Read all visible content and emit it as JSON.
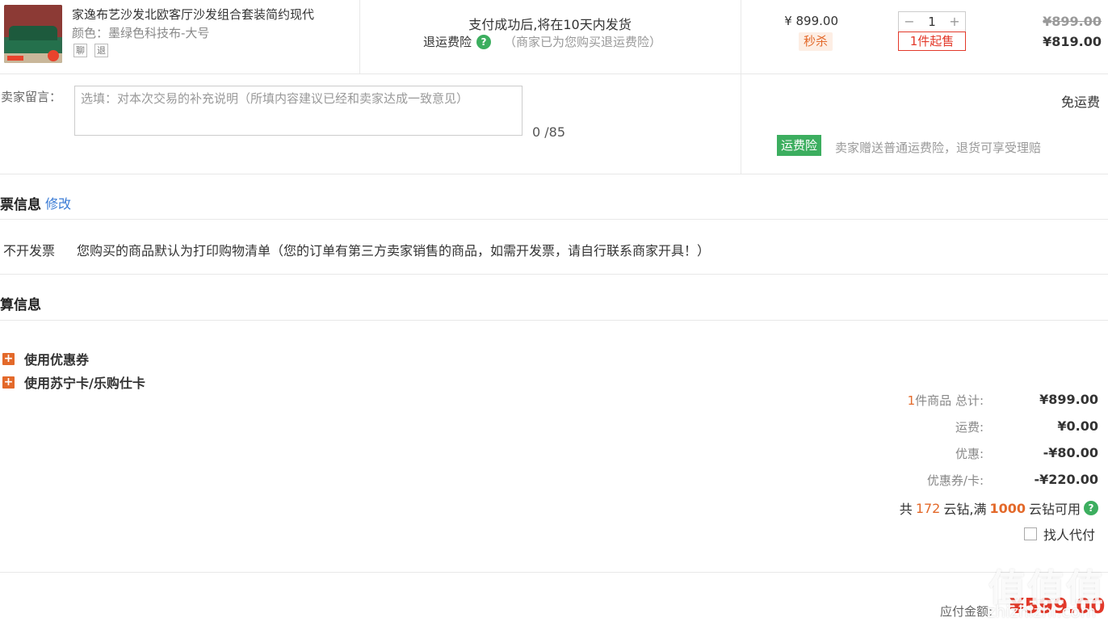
{
  "product": {
    "title": "家逸布艺沙发北欧客厅沙发组合套装简约现代",
    "color": "颜色：墨绿色科技布-大号",
    "badge_1": "聊",
    "badge_2": "退",
    "ship_note": "支付成功后,将在10天内发货",
    "return_label": "退运费险",
    "return_note": "（商家已为您购买退运费险）",
    "unit_price": "¥ 899.00",
    "flash_tag": "秒杀",
    "qty_minus": "−",
    "qty_value": "1",
    "qty_plus": "+",
    "min_buy": "1件起售",
    "orig_price": "¥899.00",
    "now_price": "¥819.00"
  },
  "message": {
    "label": "给卖家留言：",
    "placeholder": "选填：对本次交易的补充说明（所填内容建议已经和卖家达成一致意见）",
    "count": "0 /85",
    "free_shipping": "免运费",
    "insurance_tag": "运费险",
    "insurance_note": "卖家赠送普通运费险，退货可享受理赔"
  },
  "invoice": {
    "title": "发票信息",
    "modify": "修改",
    "type": "不开发票",
    "note": "您购买的商品默认为打印购物清单（您的订单有第三方卖家销售的商品，如需开发票，请自行联系商家开具！）"
  },
  "settlement": {
    "title": "结算信息",
    "use_coupon": "使用优惠券",
    "use_card": "使用苏宁卡/乐购仕卡",
    "count_num": "1",
    "total_label": "件商品 总计:",
    "total_value": "¥899.00",
    "freight_label": "运费:",
    "freight_value": "¥0.00",
    "discount_label": "优惠:",
    "discount_value": "-¥80.00",
    "coupon_label": "优惠券/卡:",
    "coupon_value": "-¥220.00",
    "diamond_prefix": "共",
    "diamond_num": "172",
    "diamond_mid": "云钻,满",
    "diamond_threshold": "1000",
    "diamond_suffix": "云钻可用",
    "proxy_pay": "找人代付",
    "pay_label": "应付金额:",
    "pay_value": "¥599.00"
  },
  "watermark": {
    "main": "值值值",
    "sub": "zhizhizhi.com"
  },
  "colors": {
    "accent_orange": "#e3692a",
    "accent_red": "#e3392a",
    "green": "#3cae5f",
    "link_blue": "#3a7bd5"
  }
}
